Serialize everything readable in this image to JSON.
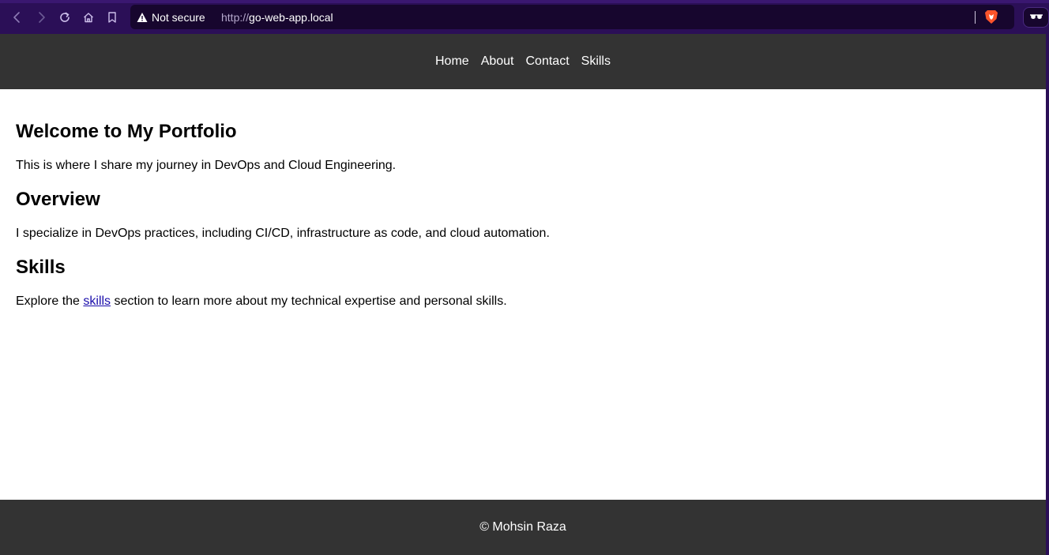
{
  "browser": {
    "security_label": "Not secure",
    "url_scheme": "http://",
    "url_host": "go-web-app.local"
  },
  "nav": {
    "items": [
      {
        "label": "Home"
      },
      {
        "label": "About"
      },
      {
        "label": "Contact"
      },
      {
        "label": "Skills"
      }
    ]
  },
  "main": {
    "welcome_heading": "Welcome to My Portfolio",
    "welcome_text": "This is where I share my journey in DevOps and Cloud Engineering.",
    "overview_heading": "Overview",
    "overview_text": "I specialize in DevOps practices, including CI/CD, infrastructure as code, and cloud automation.",
    "skills_heading": "Skills",
    "skills_text_before": "Explore the ",
    "skills_link": "skills",
    "skills_text_after": " section to learn more about my technical expertise and personal skills."
  },
  "footer": {
    "text": "© Mohsin Raza"
  },
  "colors": {
    "browser_chrome": "#2b0f57",
    "url_bar": "#17062e",
    "header_bg": "#333333",
    "link": "#1a0dab"
  }
}
